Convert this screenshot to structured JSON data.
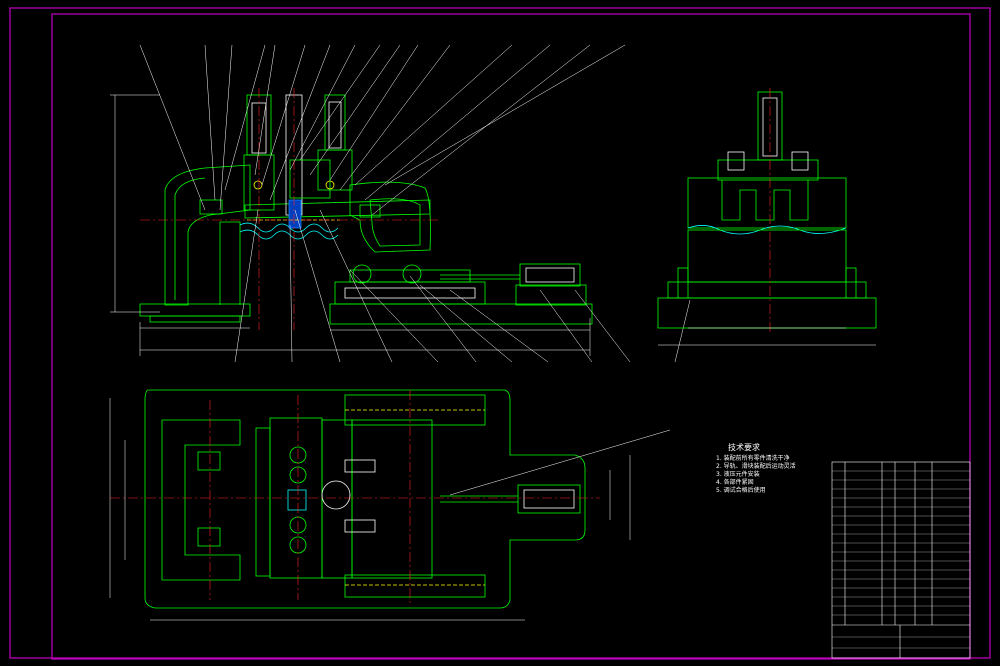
{
  "drawing": {
    "background": "#000000",
    "frame_color": "#c000c0",
    "line_colors": {
      "outline": "#00ff00",
      "leader": "#ffffff",
      "centerline": "#ff2020",
      "hidden": "#ffff00",
      "fluid": "#00ffff",
      "accent": "#ff00ff"
    },
    "technical_requirements": {
      "title": "技术要求",
      "items": [
        "1. 装配前所有零件清洗干净",
        "2. 导轨、滑块装配后运动灵活",
        "3. 液压元件安装",
        "4. 各部件紧固",
        "5. 调试合格后使用"
      ]
    }
  }
}
